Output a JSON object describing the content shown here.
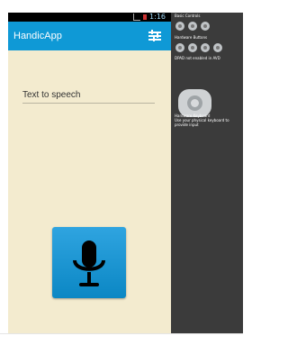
{
  "status_bar": {
    "time": "1:16"
  },
  "app": {
    "title": "HandicApp",
    "text_field": "Text to speech"
  },
  "emulator": {
    "basic_controls": "Basic Controls",
    "hardware_buttons": "Hardware Buttons",
    "dpad": "DPAD",
    "dpad_note": "not enabled in AVD",
    "hardware_keyboard": "Hardware Keyboard",
    "keyboard_note": "Use your physical keyboard to provide input"
  },
  "colors": {
    "app_bar": "#0f99d6",
    "background": "#f3ebcf",
    "mic_button": "#1d9ad8",
    "emulator_panel": "#3b3b3b"
  }
}
